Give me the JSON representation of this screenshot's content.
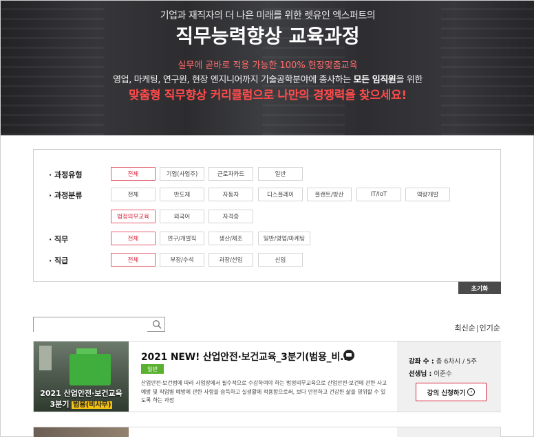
{
  "hero": {
    "subtitle": "기업과 재직자의 더 나은 미래를 위한 렛유인 엑스퍼트의",
    "title": "직무능력향상 교육과정",
    "line1": "실무에 곧바로 적용 가능한 100% 현장맞춤교육",
    "line2_pre": "영업, 마케팅, 연구원, 현장 엔지니어까지 기술공학분야에 종사하는",
    "line2_bold1": "모든 임직원",
    "line2_post": "을 위한",
    "line3": "맞춤형 직무향상 커리큘럼으로 나만의 경쟁력을 찾으세요!"
  },
  "filters": {
    "course_type": {
      "label": "· 과정유형",
      "options": [
        "전체",
        "기업(사업주)",
        "근로자카드",
        "일반"
      ],
      "selected": "전체"
    },
    "course_category": {
      "label": "· 과정분류",
      "options_row1": [
        "전체",
        "반도체",
        "자동차",
        "디스플레이",
        "플랜트/방산",
        "IT/IoT",
        "역량개발"
      ],
      "options_row2": [
        "법정의무교육",
        "외국어",
        "자격증"
      ],
      "selected": "법정의무교육"
    },
    "job": {
      "label": "· 직무",
      "options": [
        "전체",
        "연구/개발직",
        "생산/제조",
        "일반/영업/마케팅"
      ],
      "selected": "전체"
    },
    "rank": {
      "label": "· 직급",
      "options": [
        "전체",
        "부장/수석",
        "과장/선임",
        "신입"
      ],
      "selected": "전체"
    },
    "reset_label": "초기화"
  },
  "search": {
    "placeholder": "",
    "value": "",
    "icon": "search-icon"
  },
  "sort": {
    "latest": "최신순",
    "separator": "|",
    "popular": "인기순"
  },
  "courses": [
    {
      "thumb_caption1": "2021 산업안전·보건교육",
      "thumb_caption2_pre": "3분기",
      "thumb_caption2_hl": "범용(비사무)",
      "title": "2021 NEW! 산업안전·보건교육_3분기(범용_비...",
      "tag": "일반",
      "description": "산업안전·보건법에 따라 사업장에서 필수적으로 수강하여야 하는 법정의무교육으로 산업안전·보건에 관한 사고 예방 및 직업병 예방에 관한 사항을 습득하고 실생활에 적용함으로써, 보다 안전하고 건강한 삶을 영위할 수 있도록 하는 과정",
      "lectures_label": "강좌 수 :",
      "lectures_value": "총 6차시 / 5주",
      "teacher_label": "선생님 :",
      "teacher_value": "이준수",
      "apply_label": "강의 신청하기"
    }
  ],
  "colors": {
    "accent": "#d7263d",
    "tag_green": "#5ab12f",
    "reset_bg": "#4a4a4a"
  }
}
